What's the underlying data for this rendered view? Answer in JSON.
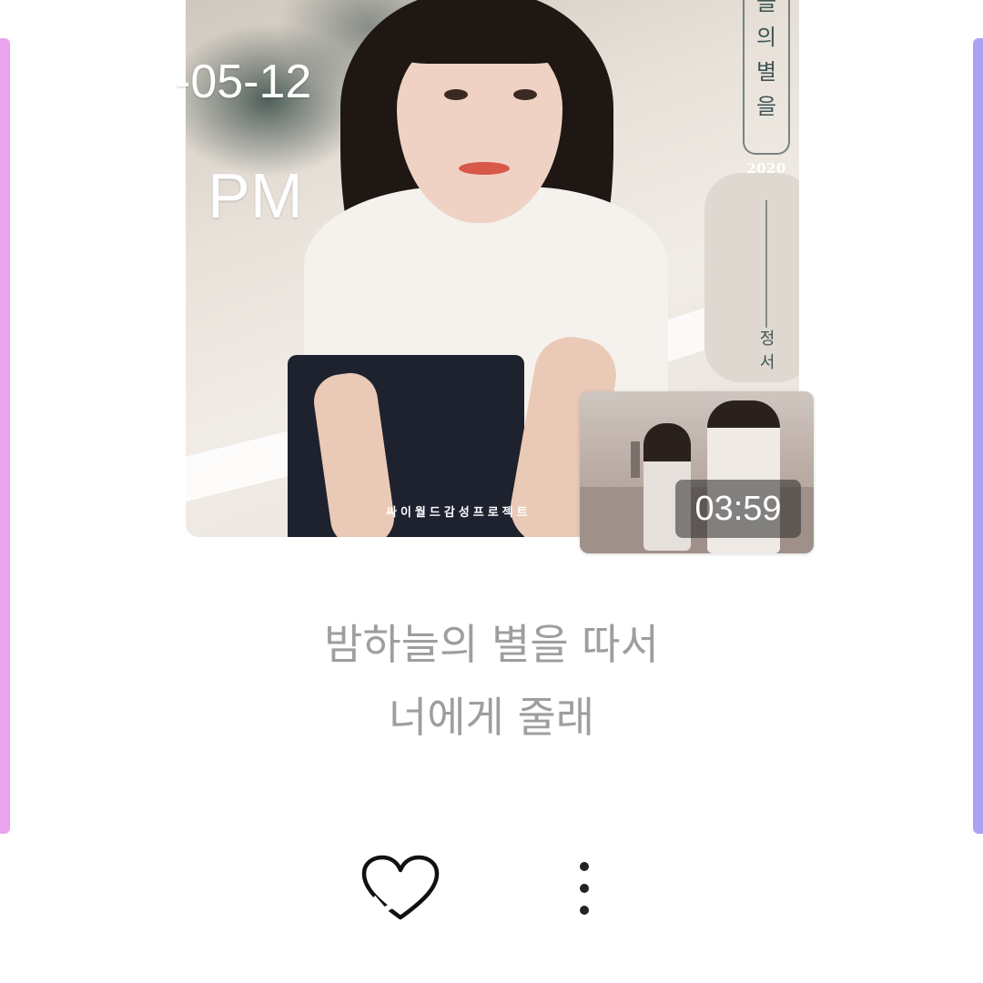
{
  "overlay": {
    "date": "-05-12",
    "ampm": "PM"
  },
  "album_art": {
    "title_vertical": "늘\n의\n별\n을",
    "year": "2020",
    "artist_vertical": "정\n서",
    "footer": "싸이월드감성프로젝트"
  },
  "video": {
    "duration": "03:59"
  },
  "lyrics": {
    "line1": "밤하늘의 별을 따서",
    "line2": "너에게 줄래"
  },
  "actions": {
    "like_icon": "heart-outline-icon",
    "more_icon": "more-vertical-icon"
  },
  "colors": {
    "left_accent": "#e9a3ef",
    "right_accent": "#a9a3f3",
    "lyrics_text": "#9e9e9e"
  }
}
